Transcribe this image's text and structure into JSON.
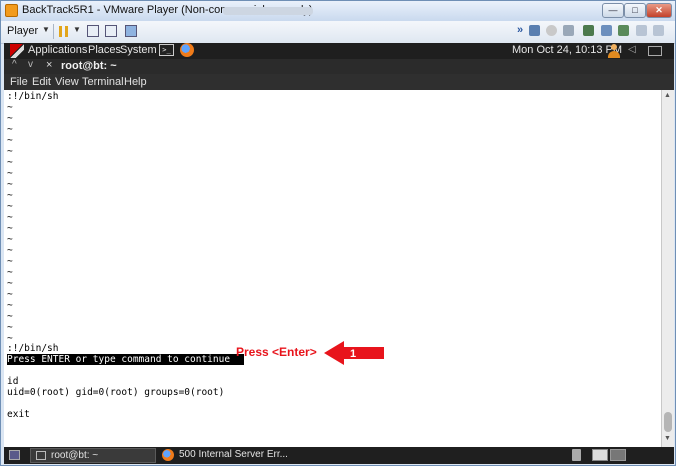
{
  "vmware": {
    "title": "BackTrack5R1 - VMware Player (Non-commercial use only)",
    "player_menu": "Player",
    "min_glyph": "—",
    "max_glyph": "□",
    "close_glyph": "✕"
  },
  "panel": {
    "applications": "Applications",
    "places": "Places",
    "system": "System",
    "clock": "Mon Oct 24, 10:13 PM"
  },
  "terminal": {
    "title": "root@bt: ~",
    "menus": [
      "File",
      "Edit",
      "View",
      "Terminal",
      "Help"
    ],
    "lines": {
      "cmd_top": ":!/bin/sh",
      "tilde": "~",
      "cmd_bottom": ":!/bin/sh",
      "status": "Press ENTER or type command to continue",
      "id_cmd": "id",
      "id_output": "uid=0(root) gid=0(root) groups=0(root)",
      "exit_cmd": "exit"
    }
  },
  "annotation": {
    "text": "Press <Enter>",
    "step_number": "1",
    "color": "#e8141c"
  },
  "taskbar": {
    "terminal_task": "root@bt: ~",
    "firefox_task": "500 Internal Server Err..."
  }
}
